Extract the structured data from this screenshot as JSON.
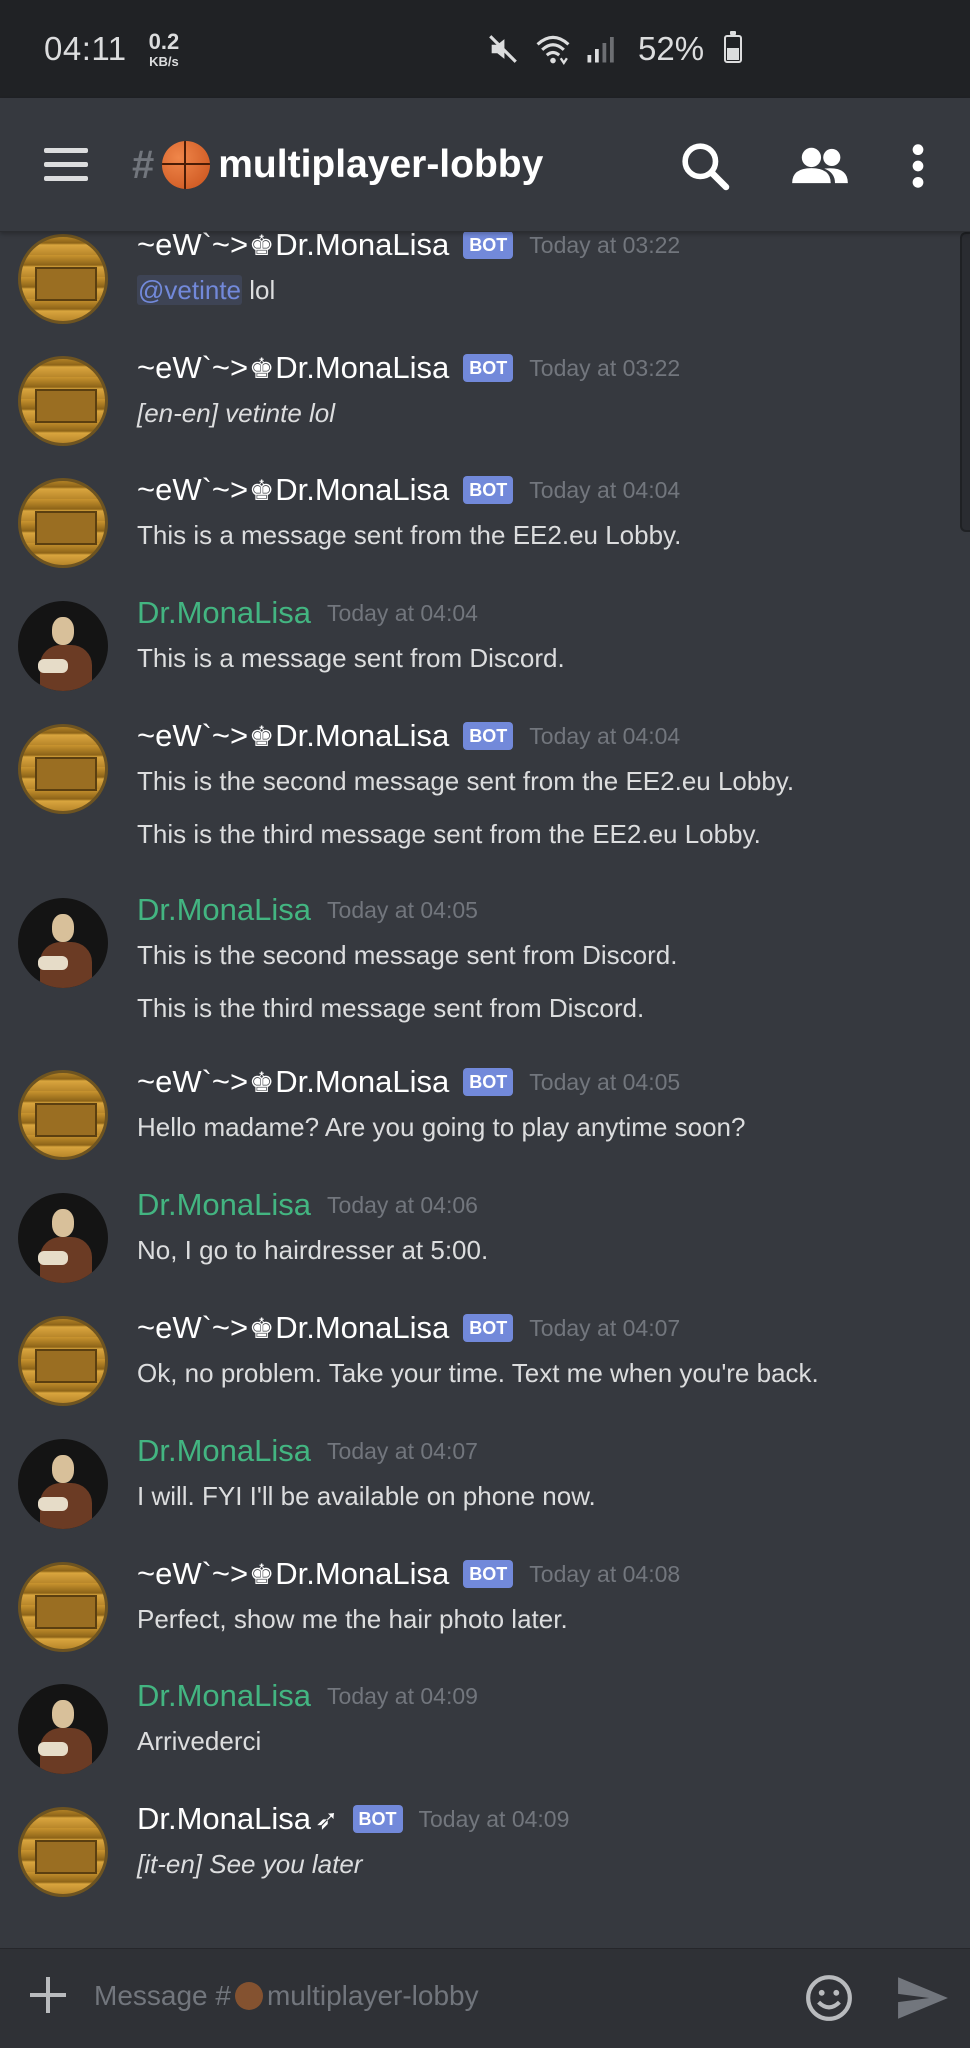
{
  "status_bar": {
    "time": "04:11",
    "speed_value": "0.2",
    "speed_unit": "KB/s",
    "battery": "52%",
    "battery_level": 0.52
  },
  "header": {
    "hash": "#",
    "channel_name": "multiplayer-lobby",
    "icons": [
      "menu-icon",
      "search-icon",
      "members-icon",
      "more-icon"
    ]
  },
  "messages": [
    {
      "author_pre": "~eW`~>",
      "author_post": "Dr.MonaLisa",
      "bot": "BOT",
      "time": "Today at 03:22",
      "lines": [
        "lol"
      ],
      "mention": "@vetinte"
    },
    {
      "author_pre": "~eW`~>",
      "author_post": "Dr.MonaLisa",
      "bot": "BOT",
      "time": "Today at 03:22",
      "lines": [
        "[en-en] vetinte lol"
      ]
    },
    {
      "author_pre": "~eW`~>",
      "author_post": "Dr.MonaLisa",
      "bot": "BOT",
      "time": "Today at 04:04",
      "lines": [
        "This is a message sent from the EE2.eu Lobby."
      ]
    },
    {
      "author": "Dr.MonaLisa",
      "time": "Today at 04:04",
      "lines": [
        "This is a message sent from Discord."
      ]
    },
    {
      "author_pre": "~eW`~>",
      "author_post": "Dr.MonaLisa",
      "bot": "BOT",
      "time": "Today at 04:04",
      "lines": [
        "This is the second message sent from the EE2.eu Lobby.",
        "This is the third message sent from the EE2.eu Lobby."
      ]
    },
    {
      "author": "Dr.MonaLisa",
      "time": "Today at 04:05",
      "lines": [
        "This is the second message sent from Discord.",
        "This is the third message sent from Discord."
      ]
    },
    {
      "author_pre": "~eW`~>",
      "author_post": "Dr.MonaLisa",
      "bot": "BOT",
      "time": "Today at 04:05",
      "lines": [
        "Hello madame? Are you going to play anytime soon?"
      ]
    },
    {
      "author": "Dr.MonaLisa",
      "time": "Today at 04:06",
      "lines": [
        "No, I go to hairdresser at 5:00."
      ]
    },
    {
      "author_pre": "~eW`~>",
      "author_post": "Dr.MonaLisa",
      "bot": "BOT",
      "time": "Today at 04:07",
      "lines": [
        "Ok, no problem. Take your time. Text me when you're back."
      ]
    },
    {
      "author": "Dr.MonaLisa",
      "time": "Today at 04:07",
      "lines": [
        "I will. FYI I'll be available on phone now."
      ]
    },
    {
      "author_pre": "~eW`~>",
      "author_post": "Dr.MonaLisa",
      "bot": "BOT",
      "time": "Today at 04:08",
      "lines": [
        "Perfect, show me the hair photo later."
      ]
    },
    {
      "author": "Dr.MonaLisa",
      "time": "Today at 04:09",
      "lines": [
        "Arrivederci"
      ]
    },
    {
      "author_plain": "Dr.MonaLisa",
      "bot": "BOT",
      "time": "Today at 04:09",
      "lines": [
        "[it-en] See you later"
      ]
    }
  ],
  "composer": {
    "placeholder_prefix": "Message #",
    "placeholder_channel": "multiplayer-lobby"
  },
  "colors": {
    "background": "#36393f",
    "statusbar": "#202225",
    "username_green": "#43b581",
    "bot_tag": "#7289da",
    "timestamp": "#72767d"
  }
}
